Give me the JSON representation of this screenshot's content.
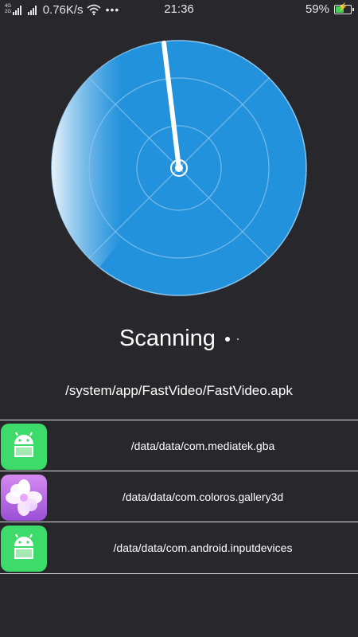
{
  "status_bar": {
    "network_labels": [
      "4G",
      "2G"
    ],
    "net_speed": "0.76K/s",
    "more_icon": "more-dots-icon",
    "time": "21:36",
    "battery_percent": "59%",
    "battery_level": 0.59,
    "battery_color": "#45d158"
  },
  "radar": {
    "fill_color": "#2392dc",
    "sweep_highlight_color": "#e8f2fa"
  },
  "scan": {
    "status_label": "Scanning",
    "current_path": "/system/app/FastVideo/FastVideo.apk"
  },
  "items": [
    {
      "path": "/data/data/com.mediatek.gba",
      "icon": "android-icon",
      "icon_color": "#3ddc6a"
    },
    {
      "path": "/data/data/com.coloros.gallery3d",
      "icon": "gallery-flower-icon",
      "icon_color": "#b866e0"
    },
    {
      "path": "/data/data/com.android.inputdevices",
      "icon": "android-icon",
      "icon_color": "#3ddc6a"
    }
  ]
}
